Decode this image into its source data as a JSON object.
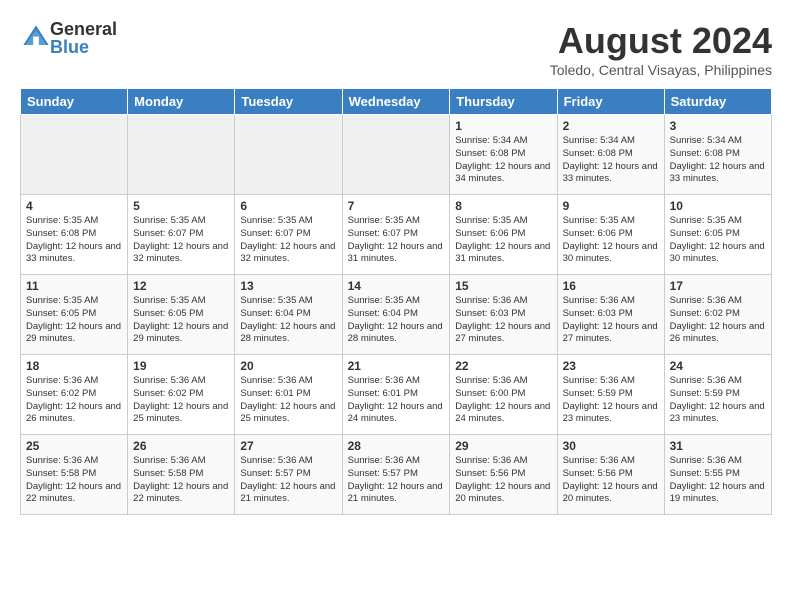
{
  "header": {
    "logo": {
      "general": "General",
      "blue": "Blue"
    },
    "title": "August 2024",
    "location": "Toledo, Central Visayas, Philippines"
  },
  "calendar": {
    "weekdays": [
      "Sunday",
      "Monday",
      "Tuesday",
      "Wednesday",
      "Thursday",
      "Friday",
      "Saturday"
    ],
    "weeks": [
      [
        {
          "day": "",
          "content": ""
        },
        {
          "day": "",
          "content": ""
        },
        {
          "day": "",
          "content": ""
        },
        {
          "day": "",
          "content": ""
        },
        {
          "day": "1",
          "content": "Sunrise: 5:34 AM\nSunset: 6:08 PM\nDaylight: 12 hours\nand 34 minutes."
        },
        {
          "day": "2",
          "content": "Sunrise: 5:34 AM\nSunset: 6:08 PM\nDaylight: 12 hours\nand 33 minutes."
        },
        {
          "day": "3",
          "content": "Sunrise: 5:34 AM\nSunset: 6:08 PM\nDaylight: 12 hours\nand 33 minutes."
        }
      ],
      [
        {
          "day": "4",
          "content": "Sunrise: 5:35 AM\nSunset: 6:08 PM\nDaylight: 12 hours\nand 33 minutes."
        },
        {
          "day": "5",
          "content": "Sunrise: 5:35 AM\nSunset: 6:07 PM\nDaylight: 12 hours\nand 32 minutes."
        },
        {
          "day": "6",
          "content": "Sunrise: 5:35 AM\nSunset: 6:07 PM\nDaylight: 12 hours\nand 32 minutes."
        },
        {
          "day": "7",
          "content": "Sunrise: 5:35 AM\nSunset: 6:07 PM\nDaylight: 12 hours\nand 31 minutes."
        },
        {
          "day": "8",
          "content": "Sunrise: 5:35 AM\nSunset: 6:06 PM\nDaylight: 12 hours\nand 31 minutes."
        },
        {
          "day": "9",
          "content": "Sunrise: 5:35 AM\nSunset: 6:06 PM\nDaylight: 12 hours\nand 30 minutes."
        },
        {
          "day": "10",
          "content": "Sunrise: 5:35 AM\nSunset: 6:05 PM\nDaylight: 12 hours\nand 30 minutes."
        }
      ],
      [
        {
          "day": "11",
          "content": "Sunrise: 5:35 AM\nSunset: 6:05 PM\nDaylight: 12 hours\nand 29 minutes."
        },
        {
          "day": "12",
          "content": "Sunrise: 5:35 AM\nSunset: 6:05 PM\nDaylight: 12 hours\nand 29 minutes."
        },
        {
          "day": "13",
          "content": "Sunrise: 5:35 AM\nSunset: 6:04 PM\nDaylight: 12 hours\nand 28 minutes."
        },
        {
          "day": "14",
          "content": "Sunrise: 5:35 AM\nSunset: 6:04 PM\nDaylight: 12 hours\nand 28 minutes."
        },
        {
          "day": "15",
          "content": "Sunrise: 5:36 AM\nSunset: 6:03 PM\nDaylight: 12 hours\nand 27 minutes."
        },
        {
          "day": "16",
          "content": "Sunrise: 5:36 AM\nSunset: 6:03 PM\nDaylight: 12 hours\nand 27 minutes."
        },
        {
          "day": "17",
          "content": "Sunrise: 5:36 AM\nSunset: 6:02 PM\nDaylight: 12 hours\nand 26 minutes."
        }
      ],
      [
        {
          "day": "18",
          "content": "Sunrise: 5:36 AM\nSunset: 6:02 PM\nDaylight: 12 hours\nand 26 minutes."
        },
        {
          "day": "19",
          "content": "Sunrise: 5:36 AM\nSunset: 6:02 PM\nDaylight: 12 hours\nand 25 minutes."
        },
        {
          "day": "20",
          "content": "Sunrise: 5:36 AM\nSunset: 6:01 PM\nDaylight: 12 hours\nand 25 minutes."
        },
        {
          "day": "21",
          "content": "Sunrise: 5:36 AM\nSunset: 6:01 PM\nDaylight: 12 hours\nand 24 minutes."
        },
        {
          "day": "22",
          "content": "Sunrise: 5:36 AM\nSunset: 6:00 PM\nDaylight: 12 hours\nand 24 minutes."
        },
        {
          "day": "23",
          "content": "Sunrise: 5:36 AM\nSunset: 5:59 PM\nDaylight: 12 hours\nand 23 minutes."
        },
        {
          "day": "24",
          "content": "Sunrise: 5:36 AM\nSunset: 5:59 PM\nDaylight: 12 hours\nand 23 minutes."
        }
      ],
      [
        {
          "day": "25",
          "content": "Sunrise: 5:36 AM\nSunset: 5:58 PM\nDaylight: 12 hours\nand 22 minutes."
        },
        {
          "day": "26",
          "content": "Sunrise: 5:36 AM\nSunset: 5:58 PM\nDaylight: 12 hours\nand 22 minutes."
        },
        {
          "day": "27",
          "content": "Sunrise: 5:36 AM\nSunset: 5:57 PM\nDaylight: 12 hours\nand 21 minutes."
        },
        {
          "day": "28",
          "content": "Sunrise: 5:36 AM\nSunset: 5:57 PM\nDaylight: 12 hours\nand 21 minutes."
        },
        {
          "day": "29",
          "content": "Sunrise: 5:36 AM\nSunset: 5:56 PM\nDaylight: 12 hours\nand 20 minutes."
        },
        {
          "day": "30",
          "content": "Sunrise: 5:36 AM\nSunset: 5:56 PM\nDaylight: 12 hours\nand 20 minutes."
        },
        {
          "day": "31",
          "content": "Sunrise: 5:36 AM\nSunset: 5:55 PM\nDaylight: 12 hours\nand 19 minutes."
        }
      ]
    ]
  }
}
